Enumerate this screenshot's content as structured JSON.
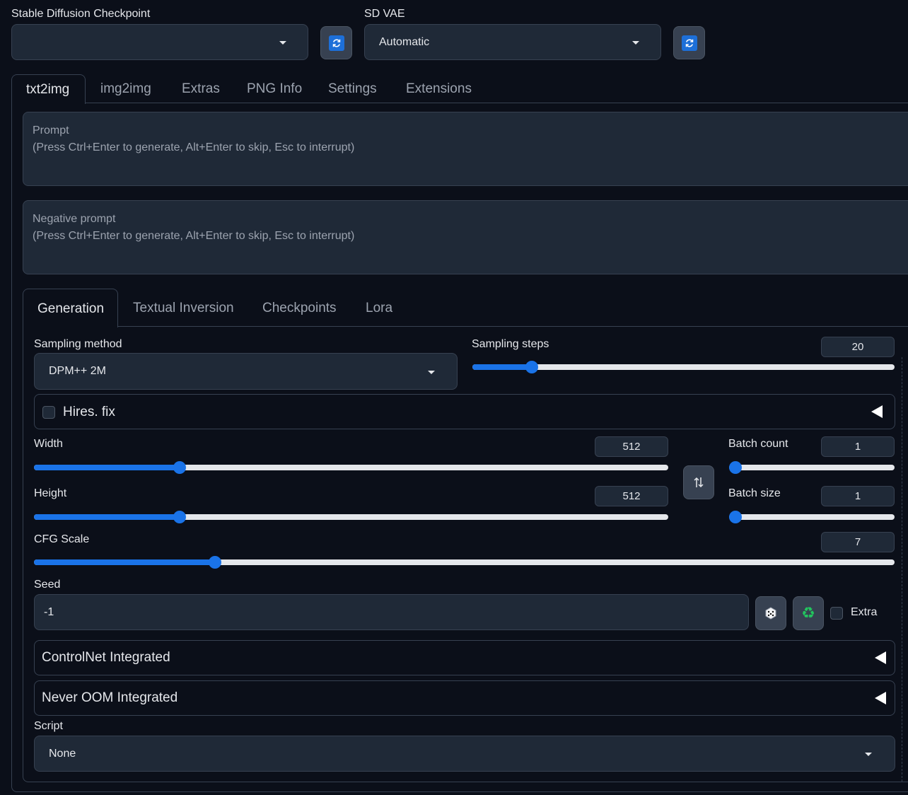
{
  "header": {
    "checkpoint_label": "Stable Diffusion Checkpoint",
    "checkpoint_value": "",
    "vae_label": "SD VAE",
    "vae_value": "Automatic"
  },
  "main_tabs": [
    "txt2img",
    "img2img",
    "Extras",
    "PNG Info",
    "Settings",
    "Extensions"
  ],
  "prompt": {
    "title": "Prompt",
    "hint": "(Press Ctrl+Enter to generate, Alt+Enter to skip, Esc to interrupt)"
  },
  "negative_prompt": {
    "title": "Negative prompt",
    "hint": "(Press Ctrl+Enter to generate, Alt+Enter to skip, Esc to interrupt)"
  },
  "sub_tabs": [
    "Generation",
    "Textual Inversion",
    "Checkpoints",
    "Lora"
  ],
  "generation": {
    "sampling_method_label": "Sampling method",
    "sampling_method_value": "DPM++ 2M",
    "sampling_steps_label": "Sampling steps",
    "sampling_steps_value": "20",
    "hires_fix_label": "Hires. fix",
    "width_label": "Width",
    "width_value": "512",
    "height_label": "Height",
    "height_value": "512",
    "batch_count_label": "Batch count",
    "batch_count_value": "1",
    "batch_size_label": "Batch size",
    "batch_size_value": "1",
    "cfg_label": "CFG Scale",
    "cfg_value": "7",
    "seed_label": "Seed",
    "seed_value": "-1",
    "extra_label": "Extra",
    "controlnet_label": "ControlNet Integrated",
    "never_oom_label": "Never OOM Integrated",
    "script_label": "Script",
    "script_value": "None"
  },
  "slider_levels": {
    "sampling_steps": 0.14,
    "width": 0.23,
    "height": 0.23,
    "cfg": 0.21,
    "batch_count": 0.0,
    "batch_size": 0.0
  },
  "colors": {
    "background": "#0b0f19",
    "accent": "#1a73e8",
    "panel": "#1f2937"
  }
}
